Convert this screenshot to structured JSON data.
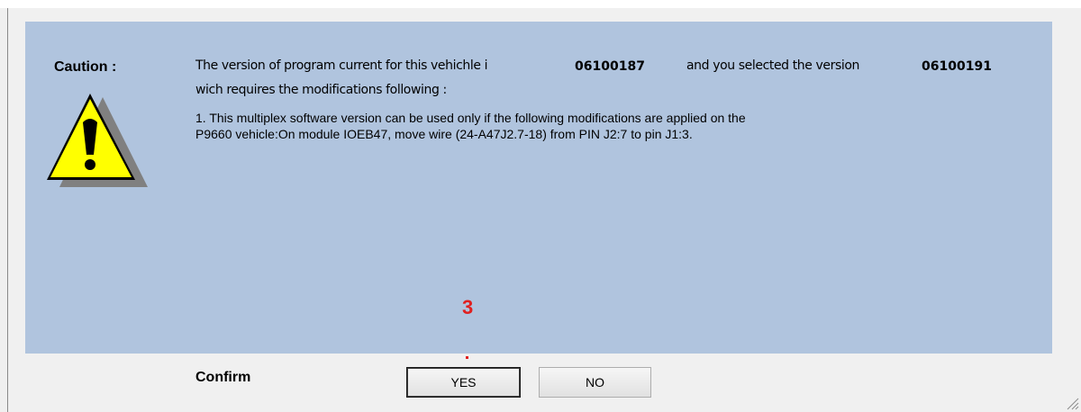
{
  "dialog": {
    "caution_label": "Caution :",
    "message_part1": "The version of program current for this vehichle i",
    "current_version": "06100187",
    "message_part2": "and you selected the version",
    "selected_version": "06100191",
    "message_line2": "wich requires the modifications following :",
    "modification_line1": "1. This multiplex software version can be used only if the following modifications are applied on the",
    "modification_line2": "P9660 vehicle:On module IOEB47, move wire (24-A47J2.7-18) from PIN J2:7 to pin J1:3.",
    "icon": "warning-icon"
  },
  "annotation": {
    "number": "3",
    "color": "#e02020"
  },
  "footer": {
    "confirm_label": "Confirm",
    "yes_label": "YES",
    "no_label": "NO"
  },
  "colors": {
    "panel": "#b0c4de",
    "window": "#f0f0f0",
    "warning_fill": "#ffff00"
  }
}
